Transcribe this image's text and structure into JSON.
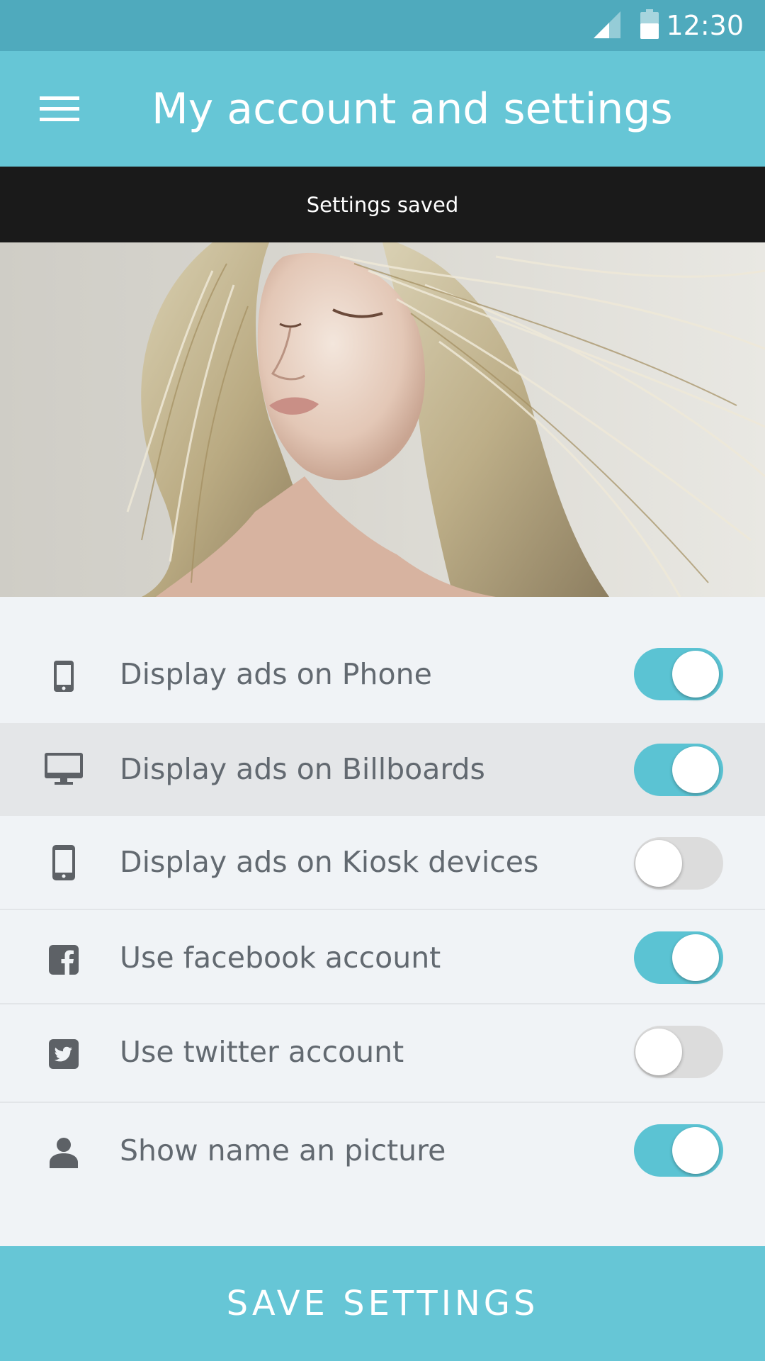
{
  "status_bar": {
    "time": "12:30",
    "icons": [
      "cell-signal-icon",
      "battery-icon"
    ]
  },
  "app_bar": {
    "menu_icon": "hamburger-menu-icon",
    "title": "My account and settings"
  },
  "snackbar": {
    "message": "Settings saved"
  },
  "hero": {
    "image": "woman-portrait-photo"
  },
  "settings": [
    {
      "icon": "smartphone-icon",
      "label": "Display ads on Phone",
      "enabled": true
    },
    {
      "icon": "monitor-icon",
      "label": "Display ads on Billboards",
      "enabled": true
    },
    {
      "icon": "kiosk-device-icon",
      "label": "Display ads on Kiosk devices",
      "enabled": false
    },
    {
      "icon": "facebook-icon",
      "label": "Use facebook account",
      "enabled": true
    },
    {
      "icon": "twitter-icon",
      "label": "Use twitter account",
      "enabled": false
    },
    {
      "icon": "user-icon",
      "label": "Show name an picture",
      "enabled": true
    }
  ],
  "save_button": {
    "label": "SAVE SETTINGS"
  },
  "colors": {
    "status_bar": "#4faabd",
    "app_bar": "#66c6d6",
    "toggle_on": "#5bc3d3",
    "toggle_off": "#dcdcdc",
    "snackbar": "#1a1a1a",
    "list_background": "#f0f3f6",
    "label_text": "#626970",
    "icon": "#5d6166"
  }
}
